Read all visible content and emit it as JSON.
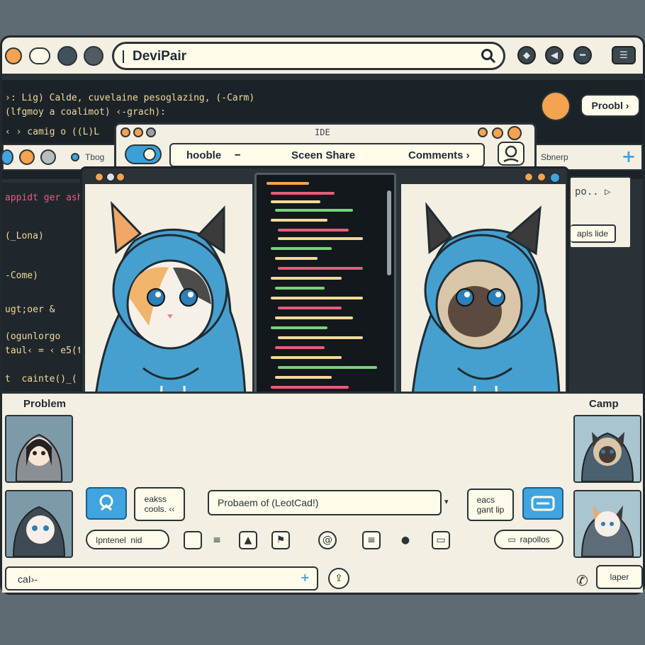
{
  "window": {
    "app_name": "DeviPair"
  },
  "header": {
    "problem_button": "Proobl ›"
  },
  "ide": {
    "title": "IDE",
    "tabs": [
      "hooble",
      "Sceen Share",
      "Comments ›"
    ]
  },
  "right_panel": {
    "tab": "Sbnerp",
    "chip_text": "apls lide"
  },
  "left_panel": {
    "tab": "Tbog"
  },
  "code_left": [
    "›: Lig) Calde, cuvelaine pesoglazing, (-Carm)",
    "(lfgmoy a coalimot) ‹-grach):",
    "‹ › camig o ((L)L"
  ],
  "code_side": [
    "appidt ger ash",
    "(_Lona)",
    "-Come)",
    "ugt;oer &",
    "(ogunlorgo",
    "taul‹ = ‹ e5(t",
    "t  cainte()_("
  ],
  "bottom": {
    "left_label": "Problem",
    "right_label": "Camp",
    "chip_left": "eakss\ncools. ‹‹",
    "problem_field": "Probaem of (LeotCad!)",
    "chip_right": "eacs\ngant lip",
    "interest_field": "Ipntenel  nid",
    "repos_button": "rapollos",
    "chat_input": "caI›-",
    "chat_send": "+",
    "leave_button": "laper"
  },
  "icons": [
    "search-icon",
    "shield-icon",
    "back-icon",
    "minus-icon",
    "menu-icon",
    "user-icon",
    "plus-icon",
    "share-icon",
    "phone-icon"
  ],
  "colors": {
    "accent": "#3fa4e0",
    "orange": "#f4a350",
    "background": "#f3efe2",
    "dark": "#1c2328"
  }
}
